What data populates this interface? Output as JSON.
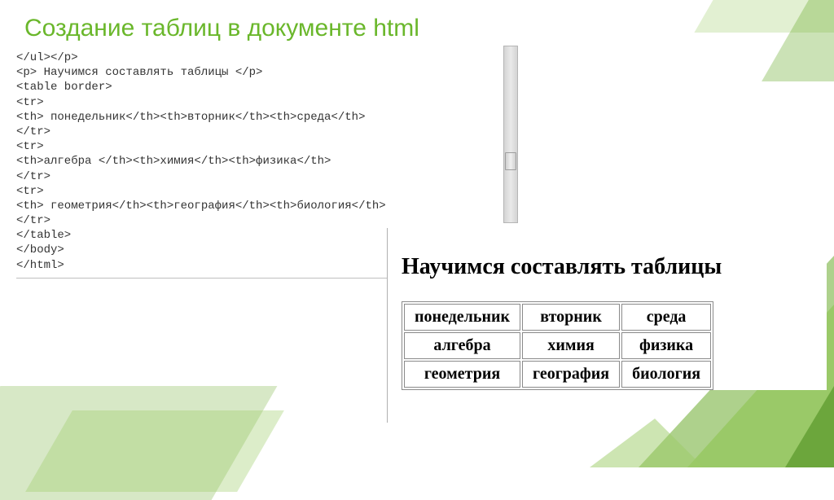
{
  "title": "Создание таблиц в документе  html",
  "code": {
    "l0": "</ul></p>",
    "l1": "<p> Научимся составлять таблицы </p>",
    "l2": "<table border>",
    "l3": "<tr>",
    "l4": "<th> понедельник</th><th>вторник</th><th>среда</th>",
    "l5": "</tr>",
    "l6": "<tr>",
    "l7": "<th>алгебра </th><th>химия</th><th>физика</th>",
    "l8": "</tr>",
    "l9": "<tr>",
    "l10": "<th> геометрия</th><th>география</th><th>биология</th>",
    "l11": "</tr>",
    "l12": "</table>",
    "l13": "</body>",
    "l14": "</html>"
  },
  "render": {
    "heading": "Научимся составлять таблицы",
    "rows": [
      {
        "c0": "понедельник",
        "c1": "вторник",
        "c2": "среда"
      },
      {
        "c0": "алгебра",
        "c1": "химия",
        "c2": "физика"
      },
      {
        "c0": "геометрия",
        "c1": "география",
        "c2": "биология"
      }
    ]
  }
}
